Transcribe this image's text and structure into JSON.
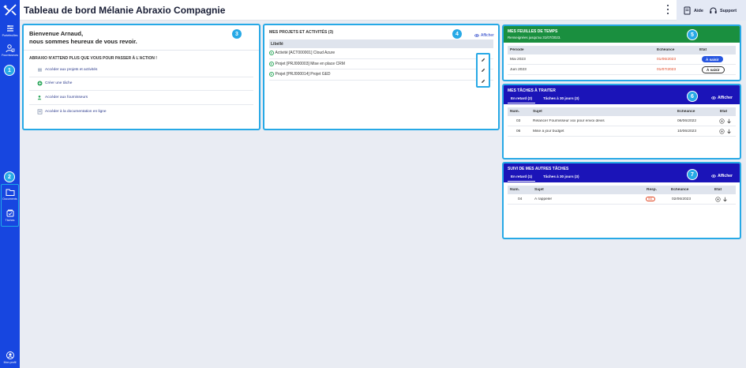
{
  "app": {
    "title": "Tableau de bord Mélanie Abraxio Compagnie"
  },
  "colors": {
    "sidebar": "#1746e0",
    "accent_highlight": "#27a9e6",
    "timesheet_header": "#1a8f3f",
    "tasks_header": "#1b14b8",
    "late_date": "#e0431f"
  },
  "sidebar": {
    "items": [
      {
        "label": "Portefeuilles",
        "icon": "portfolio-icon"
      },
      {
        "label": "Fournisseurs",
        "icon": "suppliers-icon"
      },
      {
        "label": "Documents",
        "icon": "folder-icon"
      },
      {
        "label": "Tâches",
        "icon": "tasks-icon"
      }
    ],
    "profile_label": "Mon profil",
    "badges": [
      "1",
      "2"
    ]
  },
  "header": {
    "help_label": "Aide",
    "support_label": "Support"
  },
  "welcome": {
    "badge": "3",
    "line1": "Bienvenue Arnaud,",
    "line2": "nous sommes heureux de vous revoir.",
    "subtitle": "ABRAXIO N'ATTEND PLUS QUE VOUS POUR PASSER À L'ACTION !",
    "links": [
      {
        "label": "Accéder aux projets et activités",
        "icon": "projects-icon"
      },
      {
        "label": "Créer une tâche",
        "icon": "create-task-icon"
      },
      {
        "label": "Accéder aux fournisseurs",
        "icon": "suppliers-icon"
      },
      {
        "label": "Accéder à la documentation en ligne",
        "icon": "documentation-icon"
      }
    ]
  },
  "projects": {
    "badge": "4",
    "title": "MES PROJETS ET ACTIVITÉS (3)",
    "show_label": "Afficher",
    "column_header": "Libellé",
    "rows": [
      {
        "label": "Activité [ACT000001] Cloud Azure"
      },
      {
        "label": "Projet [PRJ000003] Mise en place CRM"
      },
      {
        "label": "Projet [PRJ000014] Projet GED"
      }
    ]
  },
  "timesheets": {
    "badge": "5",
    "title": "MES FEUILLES DE TEMPS",
    "subtitle": "Renseignées jusqu'au 31/07/2023.",
    "columns": [
      "Période",
      "Échéance",
      "État"
    ],
    "rows": [
      {
        "period": "Mai 2023",
        "due": "01/06/2023",
        "state": "À saisir",
        "style": "filled"
      },
      {
        "period": "Juin 2023",
        "due": "01/07/2023",
        "state": "À saisir",
        "style": "outline"
      }
    ]
  },
  "tasks": {
    "badge": "6",
    "title": "MES TÂCHES À TRAITER",
    "show_label": "Afficher",
    "tabs": [
      "En retard (2)",
      "Tâches à 30 jours (3)"
    ],
    "columns": [
      "Num.",
      "Sujet",
      "Échéance",
      "État"
    ],
    "rows": [
      {
        "num": "03",
        "subject": "Relancer Fournisseur xxx pour envoi devis",
        "due": "06/06/2022"
      },
      {
        "num": "06",
        "subject": "Mise à jour budget",
        "due": "10/06/2023"
      }
    ]
  },
  "other_tasks": {
    "badge": "7",
    "title": "SUIVI DE MES AUTRES TÂCHES",
    "show_label": "Afficher",
    "tabs": [
      "En retard (1)",
      "Tâches à 30 jours (3)"
    ],
    "columns": [
      "Num.",
      "Sujet",
      "Resp.",
      "Échéance",
      "État"
    ],
    "rows": [
      {
        "num": "04",
        "subject": "À rappeler",
        "resp": "INL",
        "due": "02/06/2023"
      }
    ]
  }
}
